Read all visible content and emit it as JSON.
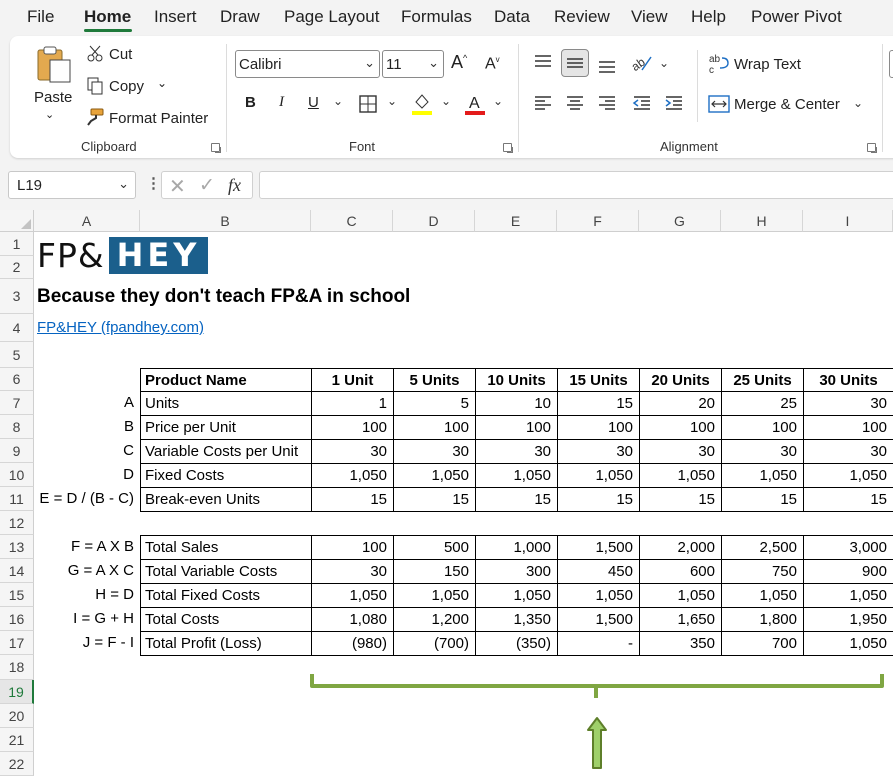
{
  "menu": {
    "items": [
      "File",
      "Home",
      "Insert",
      "Draw",
      "Page Layout",
      "Formulas",
      "Data",
      "Review",
      "View",
      "Help",
      "Power Pivot"
    ],
    "active": "Home"
  },
  "ribbon": {
    "clipboard": {
      "paste": "Paste",
      "cut": "Cut",
      "copy": "Copy",
      "format_painter": "Format Painter",
      "label": "Clipboard"
    },
    "font": {
      "family": "Calibri",
      "size": "11",
      "bold": "B",
      "italic": "I",
      "underline": "U",
      "label": "Font",
      "highlight_color": "#ffff00",
      "font_color": "#e31b1b"
    },
    "alignment": {
      "wrap_text": "Wrap Text",
      "merge_center": "Merge & Center",
      "label": "Alignment"
    }
  },
  "formula_bar": {
    "name_box": "L19",
    "fx": "fx",
    "formula": ""
  },
  "grid": {
    "columns": [
      "A",
      "B",
      "C",
      "D",
      "E",
      "F",
      "G",
      "H",
      "I"
    ],
    "rows": [
      "1",
      "2",
      "3",
      "4",
      "5",
      "6",
      "7",
      "8",
      "9",
      "10",
      "11",
      "12",
      "13",
      "14",
      "15",
      "16",
      "17",
      "18",
      "19",
      "20",
      "21",
      "22"
    ],
    "selected_row": "19",
    "logo": {
      "left": "FP&",
      "right": "HEY",
      "accent": "#1b5f8c"
    },
    "title": "Because they don't teach FP&A in school",
    "link": "FP&HEY (fpandhey.com)",
    "table1": {
      "header": [
        "Product Name",
        "1 Unit",
        "5 Units",
        "10 Units",
        "15 Units",
        "20 Units",
        "25 Units",
        "30 Units"
      ],
      "rows": [
        {
          "code": "A",
          "name": "Units",
          "values": [
            "1",
            "5",
            "10",
            "15",
            "20",
            "25",
            "30"
          ]
        },
        {
          "code": "B",
          "name": "Price per Unit",
          "values": [
            "100",
            "100",
            "100",
            "100",
            "100",
            "100",
            "100"
          ]
        },
        {
          "code": "C",
          "name": "Variable Costs per Unit",
          "values": [
            "30",
            "30",
            "30",
            "30",
            "30",
            "30",
            "30"
          ]
        },
        {
          "code": "D",
          "name": "Fixed Costs",
          "values": [
            "1,050",
            "1,050",
            "1,050",
            "1,050",
            "1,050",
            "1,050",
            "1,050"
          ]
        },
        {
          "code": "E = D / (B - C)",
          "name": "Break-even Units",
          "values": [
            "15",
            "15",
            "15",
            "15",
            "15",
            "15",
            "15"
          ]
        }
      ]
    },
    "table2": {
      "rows": [
        {
          "code": "F = A X B",
          "name": "Total Sales",
          "values": [
            "100",
            "500",
            "1,000",
            "1,500",
            "2,000",
            "2,500",
            "3,000"
          ]
        },
        {
          "code": "G = A X C",
          "name": "Total Variable Costs",
          "values": [
            "30",
            "150",
            "300",
            "450",
            "600",
            "750",
            "900"
          ]
        },
        {
          "code": "H = D",
          "name": "Total Fixed Costs",
          "values": [
            "1,050",
            "1,050",
            "1,050",
            "1,050",
            "1,050",
            "1,050",
            "1,050"
          ]
        },
        {
          "code": "I = G + H",
          "name": "Total Costs",
          "values": [
            "1,080",
            "1,200",
            "1,350",
            "1,500",
            "1,650",
            "1,800",
            "1,950"
          ]
        },
        {
          "code": "J = F - I",
          "name": "Total Profit (Loss)",
          "values": [
            "(980)",
            "(700)",
            "(350)",
            "-",
            "350",
            "700",
            "1,050"
          ]
        }
      ]
    },
    "annotation_color": "#7fa642",
    "arrow_fill": "#9fd06a"
  }
}
